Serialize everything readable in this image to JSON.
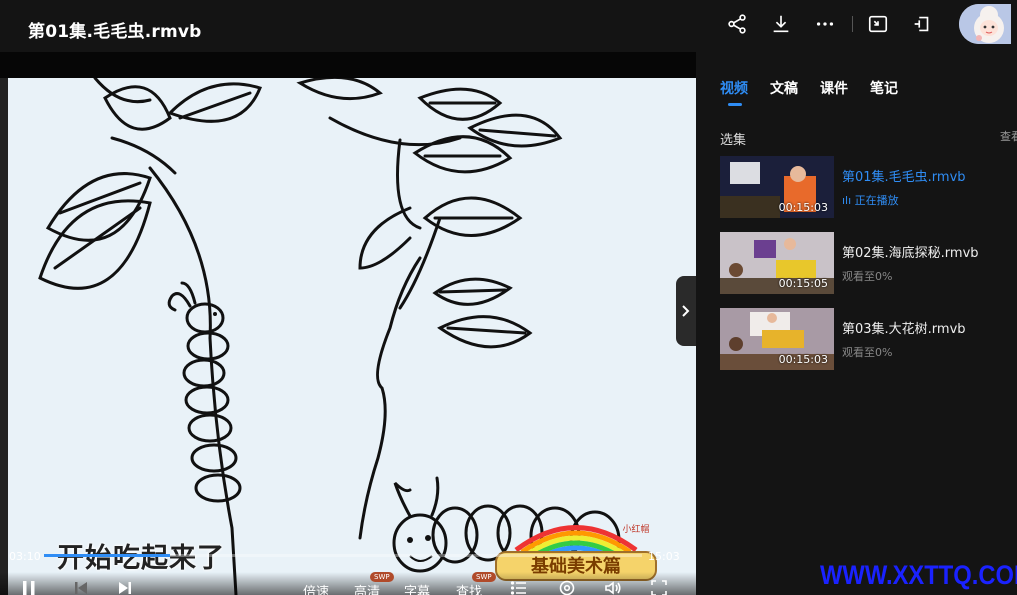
{
  "window": {
    "title": "第01集.毛毛虫.rmvb"
  },
  "toolbar": {
    "icons": [
      "share-icon",
      "download-icon",
      "more-icon",
      "picture-in-picture-icon",
      "pin-icon"
    ]
  },
  "player": {
    "subtitle": "开始吃起来了",
    "current_time": "03:10",
    "total_time": "15:03",
    "progress": 0.21,
    "controls": {
      "speed_label": "倍速",
      "quality_label": "高清",
      "quality_badge": "SWP",
      "subtitle_label": "字幕",
      "search_label": "查找",
      "search_badge": "SWP"
    },
    "logo_text": "基础美术篇",
    "logo_small_text": "小红帽"
  },
  "panel": {
    "tabs": [
      {
        "label": "视频",
        "active": true
      },
      {
        "label": "文稿",
        "active": false
      },
      {
        "label": "课件",
        "active": false
      },
      {
        "label": "笔记",
        "active": false
      }
    ],
    "section_title": "选集",
    "section_more": "查看",
    "episodes": [
      {
        "title": "第01集.毛毛虫.rmvb",
        "duration": "00:15:03",
        "status": "正在播放",
        "active": true
      },
      {
        "title": "第02集.海底探秘.rmvb",
        "duration": "00:15:05",
        "status": "观看至0%",
        "active": false
      },
      {
        "title": "第03集.大花树.rmvb",
        "duration": "00:15:03",
        "status": "观看至0%",
        "active": false
      }
    ]
  },
  "watermark": "WWW.XXTTQ.COM",
  "colors": {
    "accent": "#2f8df5",
    "background": "#141414",
    "watermark": "#1a22ff"
  }
}
